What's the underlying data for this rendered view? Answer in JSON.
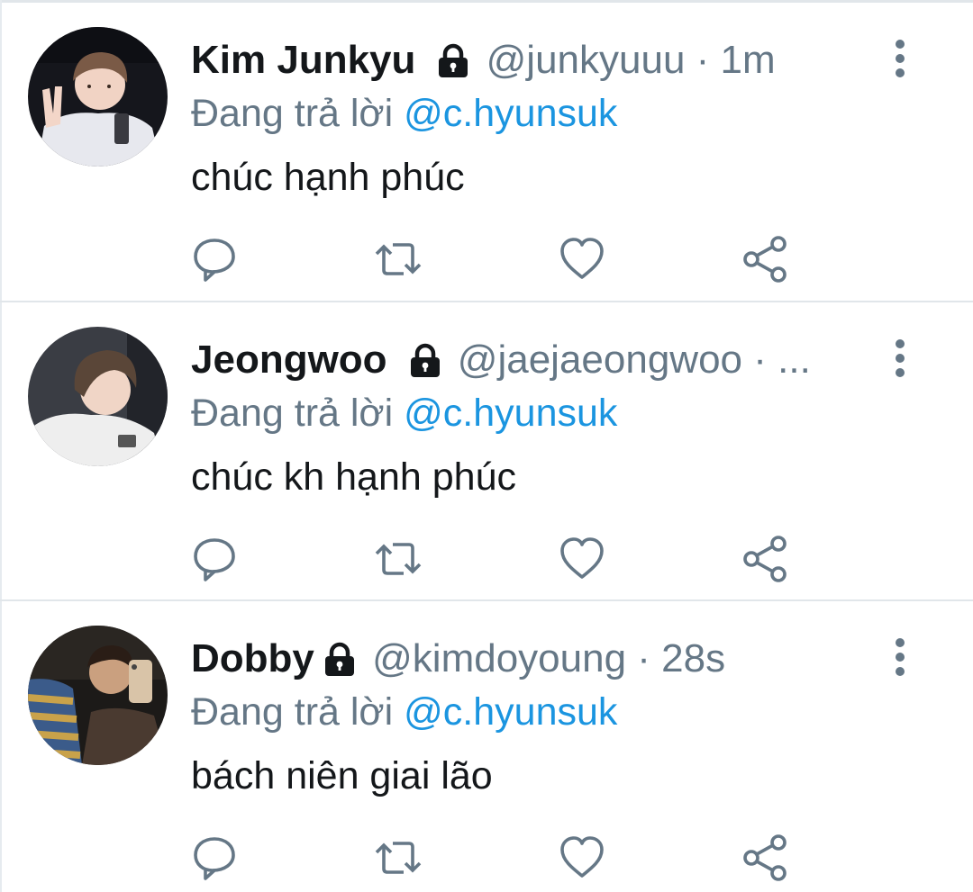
{
  "tweets": [
    {
      "name": "Kim Junkyu",
      "handle": "@junkyuuu",
      "separator": "·",
      "time": "1m",
      "replying_prefix": "Đang trả lời",
      "replying_to": "@c.hyunsuk",
      "text": "chúc hạnh phúc"
    },
    {
      "name": "Jeongwoo",
      "handle": "@jaejaeongwoo",
      "separator": "·",
      "time": "...",
      "replying_prefix": "Đang trả lời",
      "replying_to": "@c.hyunsuk",
      "text": "chúc kh hạnh phúc"
    },
    {
      "name": "Dobby",
      "handle": "@kimdoyoung",
      "separator": "·",
      "time": "28s",
      "replying_prefix": "Đang trả lời",
      "replying_to": "@c.hyunsuk",
      "text": "bách niên giai lão"
    }
  ],
  "icons": {
    "protected": "lock-icon",
    "more": "more-vertical-icon",
    "reply": "reply-icon",
    "retweet": "retweet-icon",
    "like": "heart-icon",
    "share": "share-icon"
  },
  "colors": {
    "name": "#14171a",
    "secondary": "#657786",
    "mention": "#1b95e0",
    "divider": "#e1e6ea"
  }
}
